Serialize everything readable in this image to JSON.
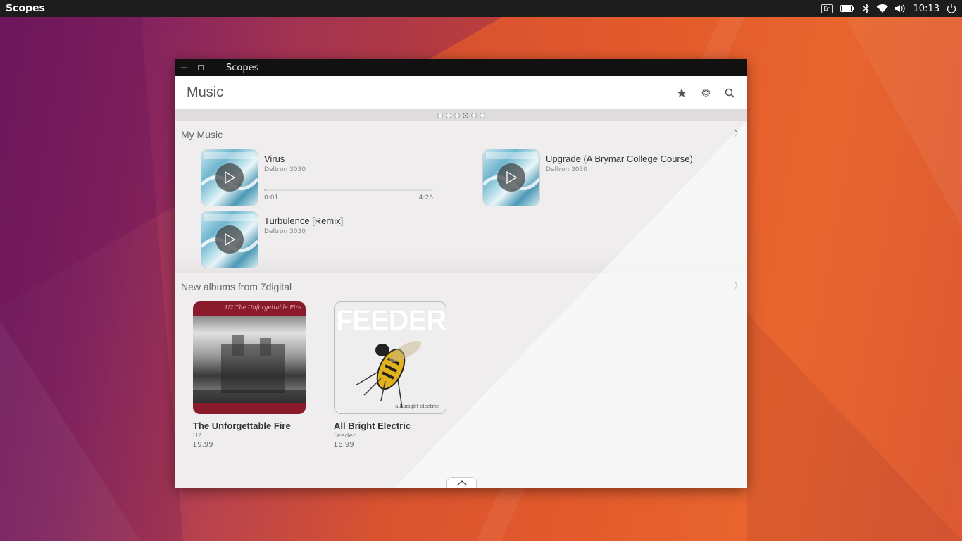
{
  "panel": {
    "app_name": "Scopes",
    "keyboard_layout": "En",
    "clock": "10:13"
  },
  "window": {
    "title": "Scopes",
    "header": {
      "title": "Music",
      "icons": [
        "star-icon",
        "settings-icon",
        "search-icon"
      ]
    },
    "page_dots": {
      "count": 6,
      "active_index": 3
    },
    "my_music": {
      "title": "My Music",
      "tracks": [
        {
          "title": "Virus",
          "artist": "Deltron 3030",
          "elapsed": "0:01",
          "duration": "4:26",
          "progress": 0.004
        },
        {
          "title": "Upgrade (A Brymar College Course)",
          "artist": "Deltron 3030"
        },
        {
          "title": "Turbulence [Remix]",
          "artist": "Deltron 3030"
        }
      ]
    },
    "new_albums": {
      "title": "New albums from 7digital",
      "albums": [
        {
          "title": "The Unforgettable Fire",
          "artist": "U2",
          "price": "£9.99",
          "cover_text": "U2 The Unforgettable Fire"
        },
        {
          "title": "All Bright Electric",
          "artist": "Feeder",
          "price": "£8.99",
          "cover_text": "FEEDER",
          "cover_subtext": "all bright electric"
        }
      ]
    }
  }
}
